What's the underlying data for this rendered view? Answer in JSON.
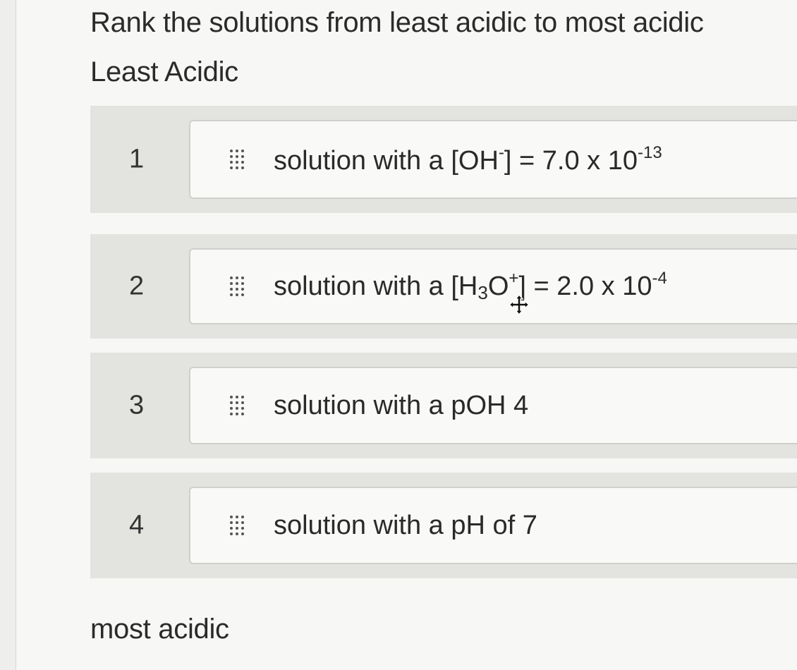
{
  "question": "Rank the solutions from least acidic to most acidic",
  "top_label": "Least Acidic",
  "bottom_label": "most acidic",
  "items": [
    {
      "rank": "1",
      "parts": [
        "solution with a [OH",
        "-",
        "] = 7.0 x 10",
        "-13"
      ]
    },
    {
      "rank": "2",
      "parts": [
        "solution with a [H",
        "3",
        "O",
        "+",
        "] = 2.0 x 10",
        "-4"
      ]
    },
    {
      "rank": "3",
      "text": "solution with a pOH 4"
    },
    {
      "rank": "4",
      "text": "solution with a pH of 7"
    }
  ]
}
